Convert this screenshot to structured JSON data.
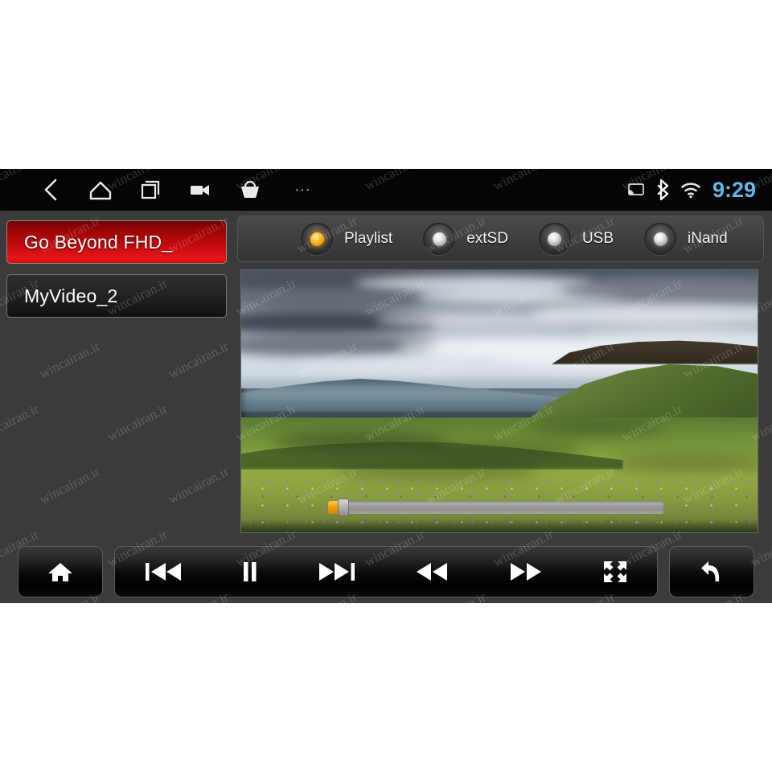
{
  "device": {
    "screen_background": "#3b3b3b",
    "page_background": "#ffffff"
  },
  "status_bar": {
    "background": "#050505",
    "clock": "9:29",
    "clock_color": "#62b6e6",
    "nav_icons": [
      {
        "name": "back-icon",
        "label": "Back"
      },
      {
        "name": "home-icon",
        "label": "Home"
      },
      {
        "name": "recent-apps-icon",
        "label": "Recent apps"
      },
      {
        "name": "video-camera-icon",
        "label": "Camera"
      },
      {
        "name": "shopping-basket-icon",
        "label": "Apps"
      },
      {
        "name": "overflow-menu-icon",
        "label": "..."
      }
    ],
    "overflow_label": "...",
    "tray_icons": [
      {
        "name": "cast-icon",
        "label": "Screen cast"
      },
      {
        "name": "bluetooth-icon",
        "label": "Bluetooth"
      },
      {
        "name": "wifi-icon",
        "label": "Wi-Fi"
      }
    ]
  },
  "playlist": {
    "items": [
      {
        "label": "Go Beyond FHD_",
        "selected": true
      },
      {
        "label": "MyVideo_2",
        "selected": false
      }
    ],
    "selected_color": "#d0100f"
  },
  "source_selector": {
    "options": [
      {
        "label": "Playlist",
        "active": true
      },
      {
        "label": "extSD",
        "active": false
      },
      {
        "label": "USB",
        "active": false
      },
      {
        "label": "iNand",
        "active": false
      }
    ],
    "active_indicator_color": "#ffc42a",
    "inactive_indicator_color": "#e8e8e8"
  },
  "video": {
    "scene_description": "Green mountain meadow with wildflowers under dramatic cloudy sky",
    "seek": {
      "progress_percent": 3,
      "thumb_percent": 3,
      "fill_color": "#f2a000",
      "track_color": "#9d9d9d"
    }
  },
  "controls": {
    "home_button": {
      "name": "home-button",
      "icon": "home-icon"
    },
    "back_button": {
      "name": "back-button",
      "icon": "return-arrow-icon"
    },
    "transport": [
      {
        "name": "previous-track-button",
        "icon": "skip-previous-icon"
      },
      {
        "name": "pause-button",
        "icon": "pause-icon"
      },
      {
        "name": "next-track-button",
        "icon": "skip-next-icon"
      },
      {
        "name": "rewind-button",
        "icon": "rewind-icon"
      },
      {
        "name": "fast-forward-button",
        "icon": "fast-forward-icon"
      },
      {
        "name": "fullscreen-button",
        "icon": "fullscreen-icon"
      }
    ]
  },
  "watermark": {
    "text": "wincairan.ir",
    "color": "rgba(255,255,255,0.19)"
  }
}
